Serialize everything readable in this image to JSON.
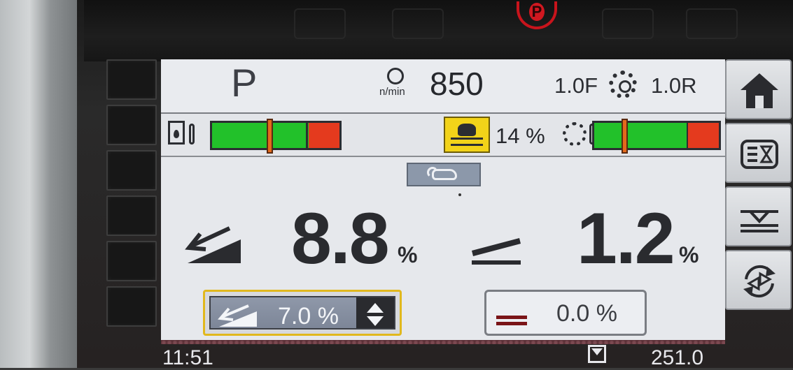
{
  "hardware": {
    "park_lamp": "P",
    "colors": {
      "lamp_red": "#c8141c"
    }
  },
  "header": {
    "gear": "P",
    "engine_unit": "n/min",
    "engine_speed": "850",
    "forward_ratio": "1.0F",
    "reverse_ratio": "1.0R",
    "icons": [
      "engine-icon",
      "transmission-icon"
    ]
  },
  "gauges": {
    "hydraulic_temp": {
      "icon": "hydraulic-tank-temp-icon",
      "level": 0.45
    },
    "water_spray_percent": "14 %",
    "gear_oil_temp": {
      "icon": "gear-oil-temp-icon",
      "level": 0.24
    },
    "colors": {
      "green": "#22c12a",
      "red": "#e43a1e",
      "needle": "#e46a1c",
      "spray_yellow": "#f2d319"
    }
  },
  "mode": {
    "icon": "manual-mode-hand-icon"
  },
  "slope": {
    "longitudinal_value": "8.8",
    "longitudinal_unit": "%",
    "cross_value": "1.2",
    "cross_unit": "%"
  },
  "setpoints": {
    "slope_setpoint": "7.0 %",
    "cross_setpoint": "0.0 %"
  },
  "status": {
    "time": "11:51",
    "operating_hours": "251.0"
  },
  "softkeys": {
    "right": [
      "home-icon",
      "menu-list-icon",
      "screed-icon",
      "cycle-icon"
    ]
  }
}
